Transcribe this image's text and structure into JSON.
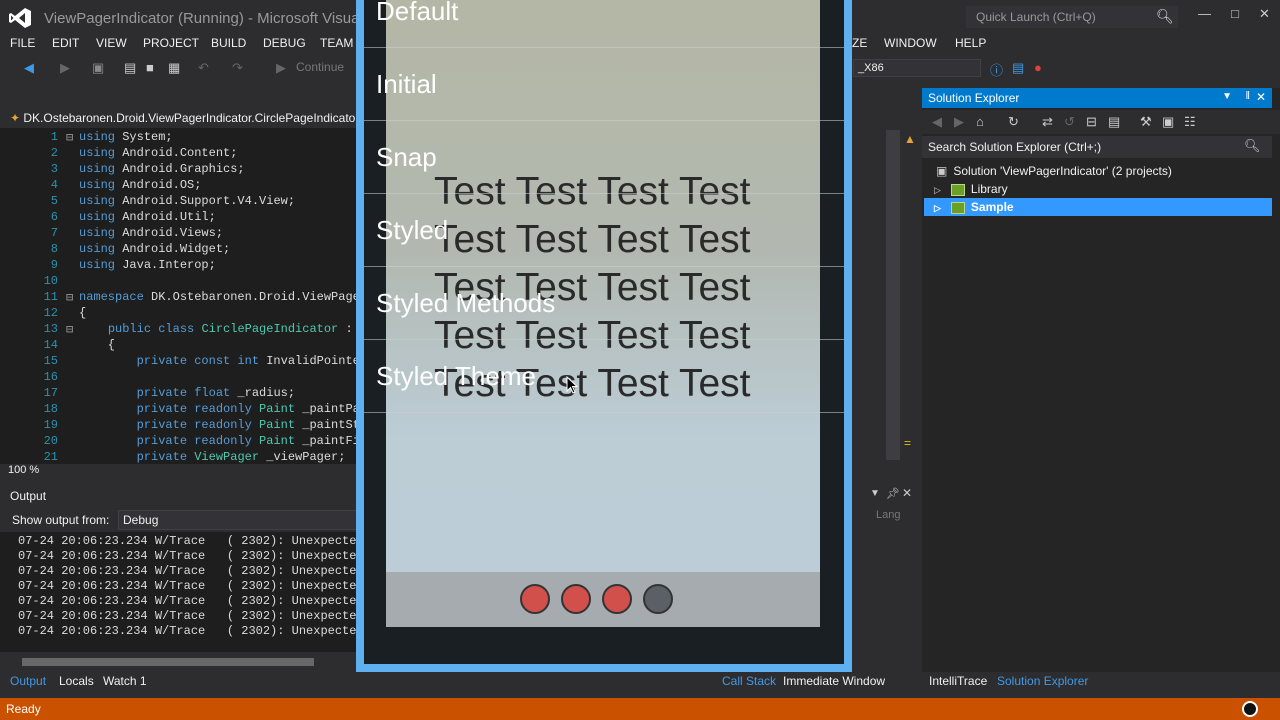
{
  "window": {
    "title": "ViewPagerIndicator (Running) - Microsoft Visual Studio",
    "quick_launch": "Quick Launch (Ctrl+Q)"
  },
  "menu": [
    "FILE",
    "EDIT",
    "VIEW",
    "PROJECT",
    "BUILD",
    "DEBUG",
    "TEAM",
    "ZE",
    "WINDOW",
    "HELP"
  ],
  "toolbar": {
    "continue_label": "Continue",
    "platform": "_X86"
  },
  "editor": {
    "tab_label": "DK.Ostebaronen.Droid.ViewPagerIndicator.CirclePageIndicator",
    "zoom": "100 %",
    "lines": [
      {
        "n": "1",
        "text": "using System;"
      },
      {
        "n": "2",
        "text": "using Android.Content;"
      },
      {
        "n": "3",
        "text": "using Android.Graphics;"
      },
      {
        "n": "4",
        "text": "using Android.OS;"
      },
      {
        "n": "5",
        "text": "using Android.Support.V4.View;"
      },
      {
        "n": "6",
        "text": "using Android.Util;"
      },
      {
        "n": "7",
        "text": "using Android.Views;"
      },
      {
        "n": "8",
        "text": "using Android.Widget;"
      },
      {
        "n": "9",
        "text": "using Java.Interop;"
      },
      {
        "n": "10",
        "text": ""
      },
      {
        "n": "11",
        "text": "namespace DK.Ostebaronen.Droid.ViewPager"
      },
      {
        "n": "12",
        "text": "{"
      },
      {
        "n": "13",
        "text": "    public class CirclePageIndicator : V"
      },
      {
        "n": "14",
        "text": "    {"
      },
      {
        "n": "15",
        "text": "        private const int InvalidPointer"
      },
      {
        "n": "16",
        "text": ""
      },
      {
        "n": "17",
        "text": "        private float _radius;"
      },
      {
        "n": "18",
        "text": "        private readonly Paint _paintPag"
      },
      {
        "n": "19",
        "text": "        private readonly Paint _paintStr"
      },
      {
        "n": "20",
        "text": "        private readonly Paint _paintFil"
      },
      {
        "n": "21",
        "text": "        private ViewPager _viewPager;"
      }
    ]
  },
  "output": {
    "title": "Output",
    "show_from_label": "Show output from:",
    "source": "Debug",
    "lines": [
      "07-24 20:06:23.234 W/Trace   ( 2302): Unexpected",
      "07-24 20:06:23.234 W/Trace   ( 2302): Unexpected",
      "07-24 20:06:23.234 W/Trace   ( 2302): Unexpected",
      "07-24 20:06:23.234 W/Trace   ( 2302): Unexpected",
      "07-24 20:06:23.234 W/Trace   ( 2302): Unexpected",
      "07-24 20:06:23.234 W/Trace   ( 2302): Unexpected",
      "07-24 20:06:23.234 W/Trace   ( 2302): Unexpected"
    ],
    "lang_label": "Lang"
  },
  "bottom_tabs": {
    "output": "Output",
    "locals": "Locals",
    "watch": "Watch 1",
    "call_stack": "Call Stack",
    "immediate": "Immediate Window",
    "intellitrace": "IntelliTrace",
    "solution_explorer": "Solution Explorer"
  },
  "solution_explorer": {
    "title": "Solution Explorer",
    "search_placeholder": "Search Solution Explorer (Ctrl+;)",
    "solution": "Solution 'ViewPagerIndicator' (2 projects)",
    "projects": [
      "Library",
      "Sample"
    ]
  },
  "status": {
    "text": "Ready",
    "accent": "#ca5100"
  },
  "emulator": {
    "list_items": [
      "Default",
      "Initial",
      "Snap",
      "Styled",
      "Styled Methods",
      "Styled Theme"
    ],
    "test_lines": [
      "Test Test Test Test",
      "Test Test Test Test",
      "Test Test Test Test",
      "Test Test Test Test",
      "Test Test Test Test"
    ],
    "page_count": 4,
    "current_page": 4,
    "dot_active_color": "#d1504b",
    "dot_current_color": "#5a6065"
  }
}
